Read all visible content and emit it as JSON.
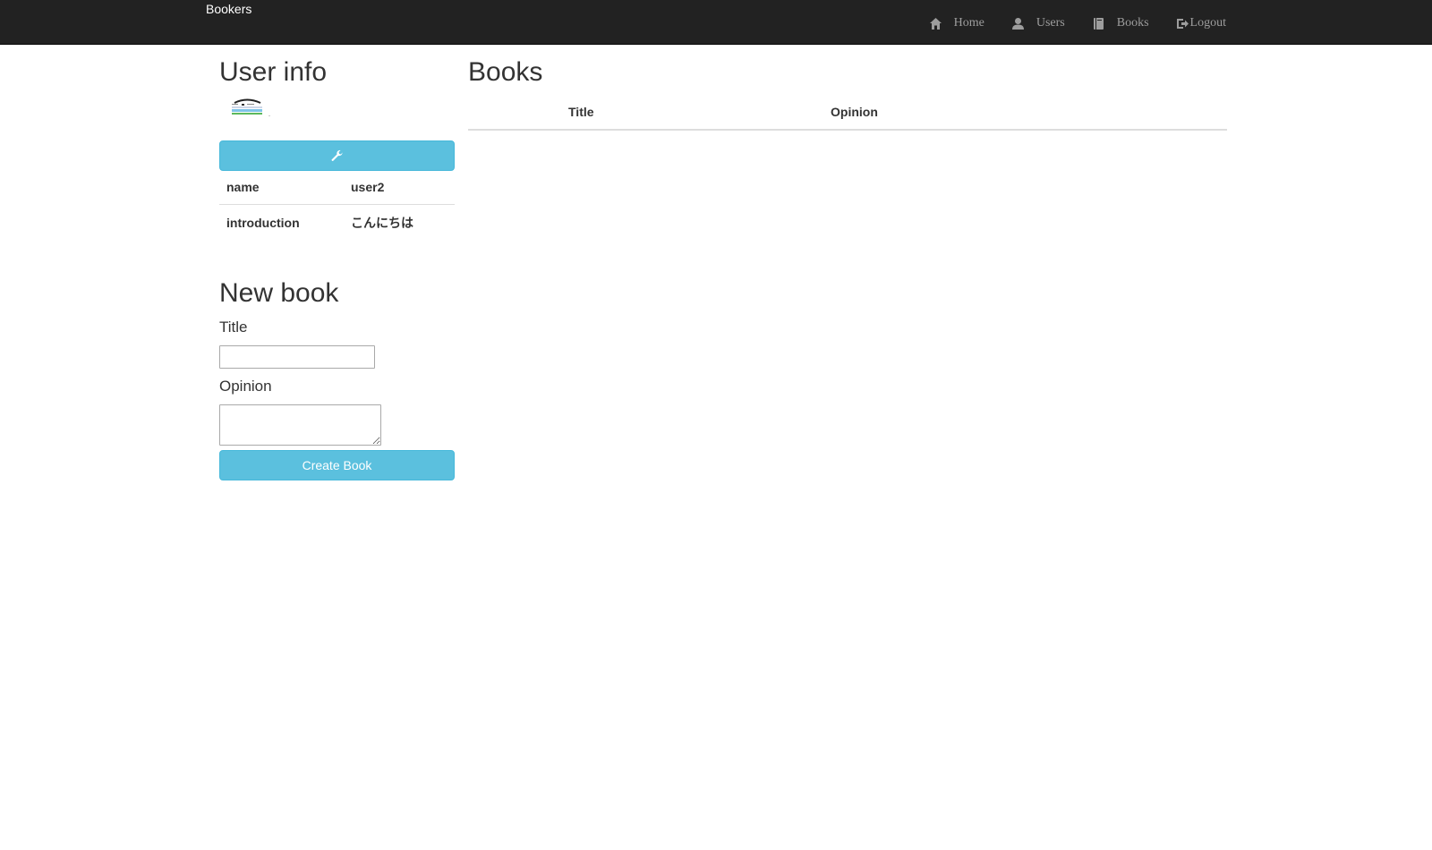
{
  "navbar": {
    "brand": "Bookers",
    "items": [
      {
        "label": "Home",
        "icon": "home-icon"
      },
      {
        "label": "Users",
        "icon": "user-icon"
      },
      {
        "label": "Books",
        "icon": "book-icon"
      },
      {
        "label": "Logout",
        "icon": "logout-icon"
      }
    ]
  },
  "user_info": {
    "heading": "User info",
    "edit_icon": "wrench-icon",
    "rows": [
      {
        "label": "name",
        "value": "user2"
      },
      {
        "label": "introduction",
        "value": "こんにちは"
      }
    ]
  },
  "new_book": {
    "heading": "New book",
    "title_label": "Title",
    "title_value": "",
    "opinion_label": "Opinion",
    "opinion_value": "",
    "submit_label": "Create Book"
  },
  "books": {
    "heading": "Books",
    "columns": [
      "",
      "Title",
      "Opinion"
    ]
  },
  "colors": {
    "navbar_bg": "#222222",
    "nav_text": "#9d9d9d",
    "button_info": "#5bc0de",
    "text": "#333333"
  }
}
